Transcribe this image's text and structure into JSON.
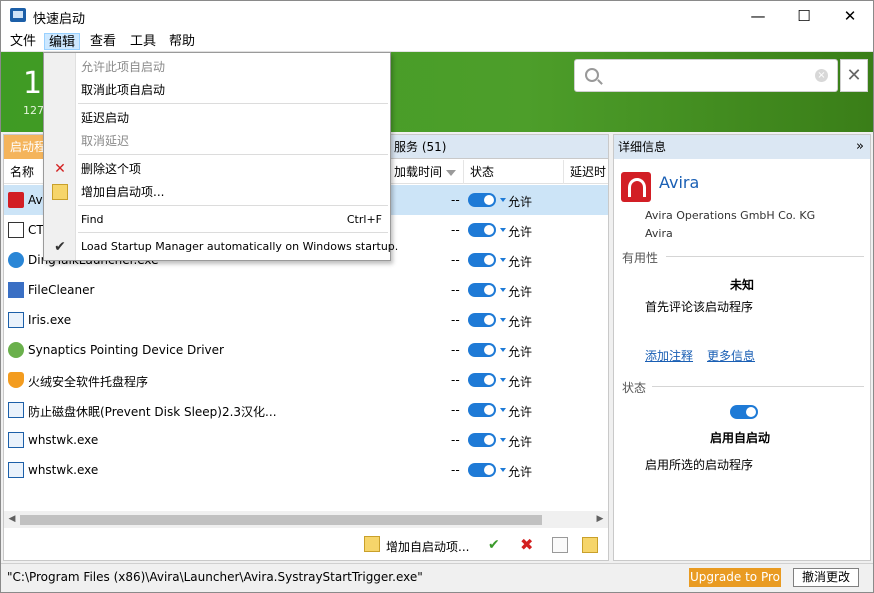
{
  "window": {
    "title": "快速启动",
    "minimize": "—",
    "maximize": "☐",
    "close": "✕"
  },
  "menu": [
    "文件",
    "编辑",
    "查看",
    "工具",
    "帮助"
  ],
  "banner": {
    "count": "15",
    "subtext": "127"
  },
  "tabs": {
    "startup": "启动程",
    "services": "服务 (51)"
  },
  "columns": {
    "name": "名称",
    "load_time": "加载时间",
    "status": "状态",
    "delay": "延迟时"
  },
  "rows": [
    {
      "name": "Avira",
      "dash": "--",
      "state": "允许",
      "icon": "avira-icon"
    },
    {
      "name": "CTF",
      "dash": "--",
      "state": "允许",
      "icon": "pen-icon"
    },
    {
      "name": "DingTalkLauncher.exe",
      "dash": "--",
      "state": "允许",
      "icon": "ding-icon"
    },
    {
      "name": "FileCleaner",
      "dash": "--",
      "state": "允许",
      "icon": "cleaner-icon"
    },
    {
      "name": "Iris.exe",
      "dash": "--",
      "state": "允许",
      "icon": "window-icon"
    },
    {
      "name": "Synaptics Pointing Device Driver",
      "dash": "--",
      "state": "允许",
      "icon": "synaptics-icon"
    },
    {
      "name": "火绒安全软件托盘程序",
      "dash": "--",
      "state": "允许",
      "icon": "shield-icon"
    },
    {
      "name": "防止磁盘休眠(Prevent Disk Sleep)2.3汉化...",
      "dash": "--",
      "state": "允许",
      "icon": "window-icon"
    },
    {
      "name": "whstwk.exe",
      "dash": "--",
      "state": "允许",
      "icon": "window-icon"
    },
    {
      "name": "whstwk.exe",
      "dash": "--",
      "state": "允许",
      "icon": "window-icon"
    }
  ],
  "bottom": {
    "add_label": "增加自启动项..."
  },
  "details": {
    "header": "详细信息",
    "chevron": "»",
    "app_name": "Avira",
    "company": "Avira Operations GmbH  Co. KG",
    "product": "Avira",
    "usefulness_label": "有用性",
    "usefulness_value": "未知",
    "first_review": "首先评论该启动程序",
    "add_comment": "添加注释",
    "more_info": "更多信息",
    "state_label": "状态",
    "state_value": "启用自启动",
    "state_desc": "启用所选的启动程序"
  },
  "status": {
    "path": "\"C:\\Program Files (x86)\\Avira\\Launcher\\Avira.SystrayStartTrigger.exe\"",
    "upgrade": "Upgrade to Pro",
    "undo": "撤消更改"
  },
  "dropdown": {
    "allow": "允许此项自启动",
    "cancel": "取消此项自启动",
    "delay": "延迟启动",
    "cancel_delay": "取消延迟",
    "delete": "删除这个项",
    "add": "增加自启动项...",
    "find": "Find",
    "find_shortcut": "Ctrl+F",
    "load": "Load Startup Manager automatically on Windows startup."
  },
  "colors": {
    "accent_green": "#3f9b24",
    "selection": "#cce4f7",
    "toggle": "#1e7ad6",
    "tab_active": "#f4b45b",
    "upgrade": "#e99b22"
  }
}
